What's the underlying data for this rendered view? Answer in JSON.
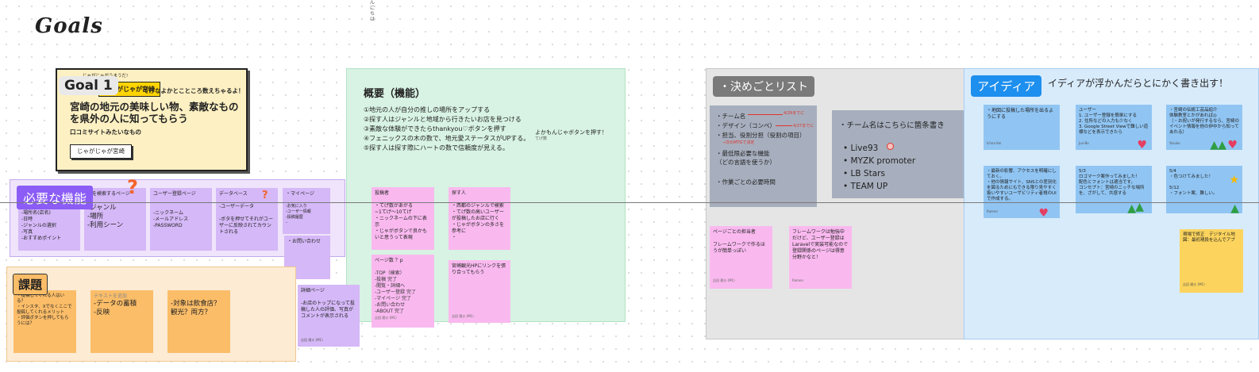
{
  "title": "Goals",
  "vertical_text": "んにちは",
  "goal1": {
    "tag": "Goal 1",
    "small": "じゃがじゃがうまうだ!",
    "yellow_label": "じゃがじゃが宮崎",
    "headline": "てげなよかとこところ数えちゃるよ！",
    "main": "宮崎の地元の美味しい物、素敵なものを県外の人に知ってもらう",
    "sub": "口コミサイトみたいなもの",
    "button": "じゃがじゃが宮崎"
  },
  "required": {
    "tag": "必要な機能",
    "notes": [
      {
        "text": "-場所名(店名)\n-日時\n-ジャンルの選択\n-写真\n-おすすめポイント"
      },
      {
        "head": "所を検索するページ",
        "text": "-ジャンル\n-場所\n-利用シーン"
      },
      {
        "head": "ユーザー登録ページ",
        "text": "-ニックネーム\n-メールアドレス\n-PASSWORD"
      },
      {
        "head": "データベース",
        "text": "-ユーザーデータ\n\n-ボタを押せてそれがユーザーに反映されてカウントされる"
      },
      {
        "head": "・マイページ",
        "text": "-お気に入り\n-ユーザー情報\n-投稿履歴\n-"
      },
      {
        "text": "・お問い合わせ"
      },
      {
        "head": "詳細ページ",
        "text": "-お店のトップになって投稿した人の評価、写真がコメントが表示される",
        "foot": "吉田 理沙 (M1)"
      }
    ]
  },
  "overview": {
    "title": "概要（機能）",
    "items": [
      "①地元の人が自分の推しの場所をアップする",
      "②探す人はジャンルと地域から行きたいお店を見つける",
      "③素敵な体験ができたらthankyou♡ボタンを押す",
      "④フェニックスの木の数で、地元愛ステータスがUPする。",
      "⑤探す人は探す際にハートの数で信頼度が見える。"
    ],
    "side": "よかもんじゃボタンを押す！",
    "side_small": "てげ数",
    "notes": [
      {
        "head": "投稿者",
        "text": "・てげ数があがる\n~1てげ〜10てげ\n・ニックネームの下に表示\n・じゃがボタンで良かもいと思うって表現"
      },
      {
        "head": "探す人",
        "text": "・西都のジャンルで検索\n・てげ数の高いユーザーが投稿したお店に行く\n・じゃがボタンの多さを参考に\n・"
      },
      {
        "head": "ページ数  ？p",
        "text": "-TOP（検索）\n-投稿  完了\n-閲覧・詳細へ\n-ユーザー登録  完了\n-マイページ  完了\n-お問い合わせ\n-ABOUT  完了",
        "foot": "吉田 理沙 (M1)"
      },
      {
        "head": "宮崎観光HPにリンクを張り合ってもらう",
        "text": "",
        "foot": "吉田 理沙 (M1)"
      }
    ]
  },
  "decisions": {
    "tag": "・決めごとリスト",
    "box1": [
      "・チーム名",
      "・デザイン（コンペ）",
      "・担当、役割分担（役割の項目）",
      "・最低限必要な機能\n（どの言語を使うか）",
      "・作業ごとの必要時間"
    ],
    "box1_red": [
      "4/29までに",
      "4/27までに",
      "→次のMTGで決定"
    ],
    "box2_head": "・チーム名はこちらに箇条書き",
    "team_names": [
      "Live93",
      "MYZK promoter",
      "LB Stars",
      "TEAM UP"
    ],
    "notes": [
      {
        "head": "ページごとの担当者",
        "text": "フレームワークで作るほうが簡単っぽい",
        "foot": "吉田 理沙 (M1)"
      },
      {
        "text": "フレームワークは勉強中だけど、ユーザー登録はLaravelで実装可能なので登録関係のページは得意分野かなと！",
        "foot": "Ramen"
      }
    ]
  },
  "ideas": {
    "tag": "アイディア",
    "text": "イディアが浮かんだらとにかく書き出す！",
    "notes": [
      {
        "text": "・地図に投稿した場所を出るようにする",
        "foot": "Ichiro Kei"
      },
      {
        "text": "ユーザー\n1. ユーザー登録を簡単にする\n2. 住所などの入力も少なく\n3. Google Street Viewで難しい道標などを表示できたら",
        "foot": "Jun-Bo"
      },
      {
        "text": "・宮崎の伝統工芸品紹介\n体験教室とかがあれば◎\n（・お祝いが発行するなら、宮崎のイベント情報を他の伊中から知ってあれる）",
        "foot": "Yosuke"
      },
      {
        "text": "・最新の影響、アクセスを明確にしておく。\n・他の情報サイト、SNSとの差別化を図るためにもできる限り見やすく扱いやすいユーザビリティ者視のUIで作成する。",
        "foot": "Ramen"
      },
      {
        "text": "5/3\nロゴマーク案作ってみました！\n配色とフォントは適当です。\nコンセプト：宮崎のニッチな場所を、ざがして、共感する",
        "foot": ""
      },
      {
        "text": "5/4\n・色つけてみました！\n\n5/12\n・フォント案、難しい。",
        "foot": ""
      },
      {
        "text": "現場で修正　デジタイル地図：最初現段を込んでアプ",
        "foot": "吉田 理沙 (M1)"
      }
    ]
  },
  "issues": {
    "tag": "課題",
    "notes": [
      {
        "text": "・投稿してくれる人はいる？\n・インスタ、Xでなくここで投稿してくれるメリット\n・評価ボタンを押してもらうには？"
      },
      {
        "head": "テキストを追加",
        "text": "-データの蓄積\n-反映"
      },
      {
        "text": "-対象は飲食店？\n観光？両方？"
      }
    ]
  },
  "colors": {
    "purple": "#8b5cf6",
    "blue": "#1d8fef",
    "orange": "#fbbd68",
    "green_panel": "#d8f3e3"
  }
}
